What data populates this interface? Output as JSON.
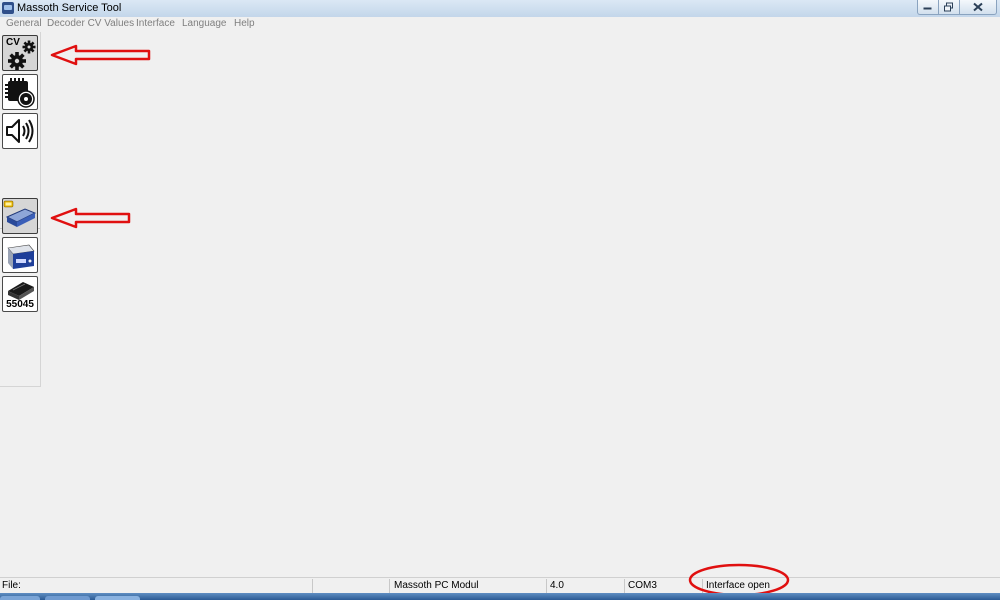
{
  "window": {
    "title": "Massoth Service Tool"
  },
  "menu": {
    "items": [
      "General",
      "Decoder CV Values",
      "Interface",
      "Language",
      "Help"
    ]
  },
  "sidebar": {
    "tools": [
      {
        "icon": "cv-settings-gears-icon",
        "label": "CV",
        "active": true
      },
      {
        "icon": "decoder-chip-disc-icon",
        "label": ""
      },
      {
        "icon": "speaker-sound-icon",
        "label": ""
      },
      {
        "icon": "pc-modul-interface-icon",
        "label": "",
        "active": true
      },
      {
        "icon": "central-station-icon",
        "label": ""
      },
      {
        "icon": "device-55045-icon",
        "label": "55045"
      }
    ]
  },
  "statusbar": {
    "file_label": "File:",
    "module": "Massoth PC Modul",
    "version": "4.0",
    "port": "COM3",
    "connection": "Interface open"
  },
  "annotations": {
    "color": "#e01010"
  }
}
